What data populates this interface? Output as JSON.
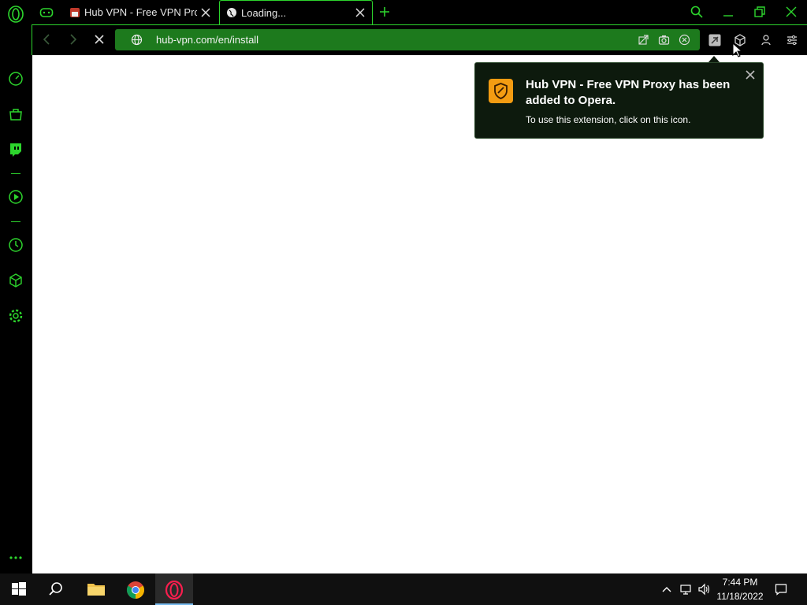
{
  "browser": {
    "tabs": [
      {
        "title": "Hub VPN - Free VPN Proxy",
        "favicon": "hub-vpn-favicon"
      },
      {
        "title": "Loading...",
        "favicon": "globe-icon"
      }
    ],
    "url": "hub-vpn.com/en/install"
  },
  "popup": {
    "title": "Hub VPN - Free VPN Proxy has been added to Opera.",
    "body": "To use this extension, click on this icon."
  },
  "taskbar": {
    "time": "7:44 PM",
    "date": "11/18/2022"
  },
  "colors": {
    "accent": "#2dd52d",
    "urlbar": "#1d7a1d",
    "popup_bg": "#0d1a0d",
    "ext_icon": "#f39c12"
  }
}
